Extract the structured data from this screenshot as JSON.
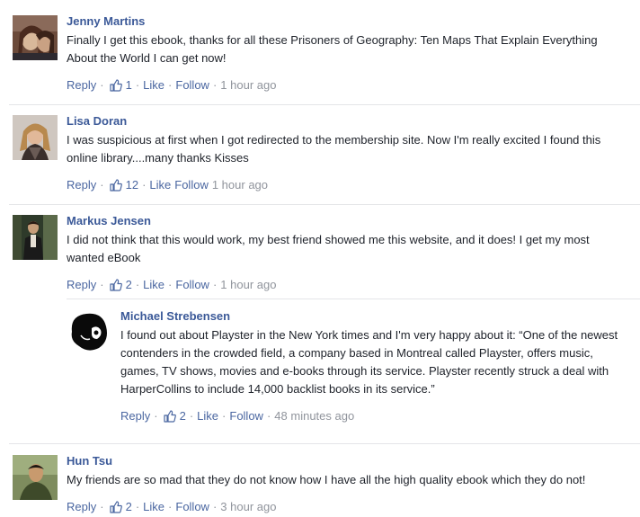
{
  "action_labels": {
    "reply": "Reply",
    "like": "Like",
    "follow": "Follow",
    "separator": "·"
  },
  "comments": [
    {
      "author": "Jenny Martins",
      "text_lines": [
        "Finally I get this ebook, thanks for all these Prisoners of Geography: Ten Maps That Explain Everything",
        "About the World I can get now!"
      ],
      "likes": "1",
      "time": "1 hour ago"
    },
    {
      "author": "Lisa Doran",
      "text_lines": [
        "I was suspicious at first when I got redirected to the membership site. Now I'm really excited I found this",
        "online library....many thanks Kisses"
      ],
      "likes": "12",
      "time": "1 hour ago"
    },
    {
      "author": "Markus Jensen",
      "text_lines": [
        "I did not think that this would work, my best friend showed me this website, and it does! I get my most",
        "wanted eBook"
      ],
      "likes": "2",
      "time": "1 hour ago"
    },
    {
      "author": "Michael Strebensen",
      "text_lines": [
        "I found out about Playster in the New York times and I'm very happy about it: “One of the newest",
        "contenders in the crowded field, a company based in Montreal called Playster, offers music,",
        "games, TV shows, movies and e-books through its service. Playster recently struck a deal with",
        "HarperCollins to include 14,000 backlist books in its service.”"
      ],
      "likes": "2",
      "time": "48 minutes ago"
    },
    {
      "author": "Hun Tsu",
      "text_lines": [
        "My friends are so mad that they do not know how I have all the high quality ebook which they do not!"
      ],
      "likes": "2",
      "time": "3 hour ago"
    }
  ]
}
